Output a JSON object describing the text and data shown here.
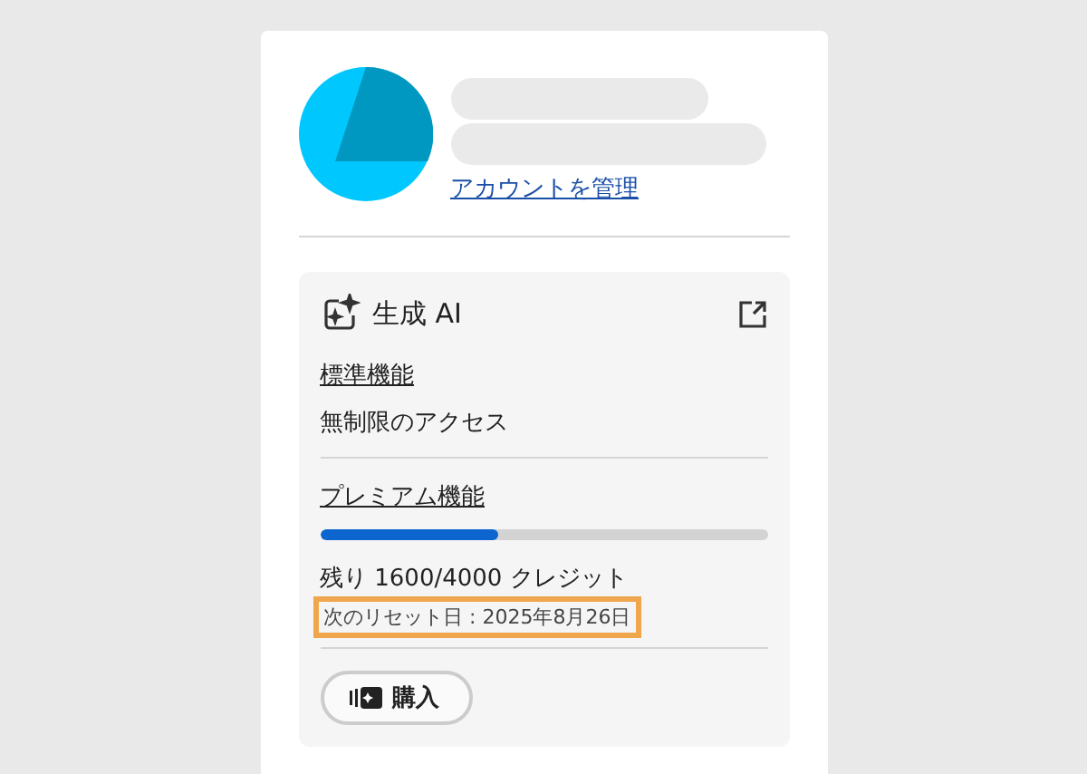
{
  "account": {
    "manage_link": "アカウントを管理"
  },
  "generative_ai": {
    "title": "生成 AI",
    "standard": {
      "label": "標準機能",
      "value": "無制限のアクセス"
    },
    "premium": {
      "label": "プレミアム機能",
      "level": 0.4,
      "credits": "残り 1600/4000 クレジット",
      "reset": "次のリセット日 : 2025年8月26日",
      "reset_highlighted": true
    },
    "buy_button": "購入"
  }
}
